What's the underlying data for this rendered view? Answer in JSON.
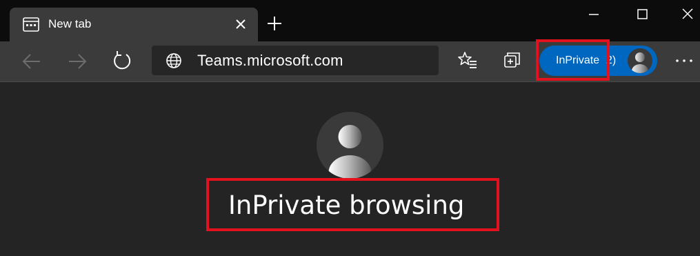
{
  "tab": {
    "title": "New tab",
    "icon": "new-tab-page-icon"
  },
  "window_controls": [
    "minimize-icon",
    "maximize-icon",
    "close-icon"
  ],
  "toolbar": {
    "address": "Teams.microsoft.com",
    "address_icon": "globe-icon",
    "inprivate_label": "InPrivate",
    "inprivate_count": "2)",
    "icons": [
      "back-arrow-icon",
      "forward-arrow-icon",
      "refresh-icon",
      "favorites-icon",
      "collections-icon",
      "more-icon"
    ]
  },
  "page": {
    "heading": "InPrivate browsing",
    "avatar_icon": "person-icon"
  },
  "colors": {
    "titlebar": "#0c0c0c",
    "toolbar": "#3b3b3b",
    "page_background": "#242424",
    "address_background": "#262626",
    "inprivate_blue": "#0067c0",
    "highlight_red": "#e3101e",
    "text": "#ffffff"
  }
}
